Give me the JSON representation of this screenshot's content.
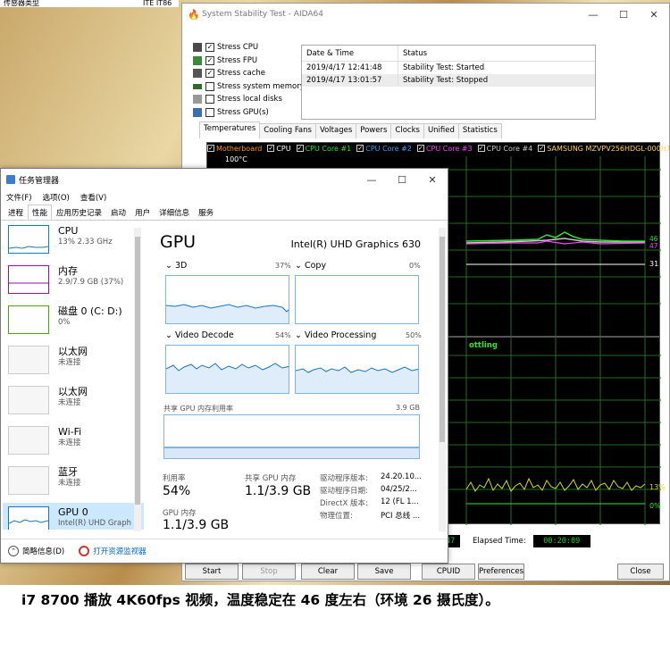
{
  "background": {
    "left_title": "传感器类型",
    "right_title": "ITE IT86"
  },
  "aida": {
    "window_title": "System Stability Test - AIDA64",
    "stress": [
      {
        "label": "Stress CPU",
        "checked": true,
        "icon": "cpu-icon"
      },
      {
        "label": "Stress FPU",
        "checked": true,
        "icon": "fpu-icon"
      },
      {
        "label": "Stress cache",
        "checked": true,
        "icon": "cache-icon"
      },
      {
        "label": "Stress system memory",
        "checked": false,
        "icon": "memory-icon"
      },
      {
        "label": "Stress local disks",
        "checked": false,
        "icon": "disk-icon"
      },
      {
        "label": "Stress GPU(s)",
        "checked": false,
        "icon": "gpu-icon"
      }
    ],
    "log": {
      "headers": [
        "Date & Time",
        "Status"
      ],
      "rows": [
        [
          "2019/4/17 12:41:48",
          "Stability Test: Started"
        ],
        [
          "2019/4/17 13:01:57",
          "Stability Test: Stopped"
        ]
      ]
    },
    "tabs": [
      "Temperatures",
      "Cooling Fans",
      "Voltages",
      "Powers",
      "Clocks",
      "Unified",
      "Statistics"
    ],
    "legend": [
      {
        "label": "Motherboard",
        "color": "#ff9900"
      },
      {
        "label": "CPU",
        "color": "#ffffff"
      },
      {
        "label": "CPU Core #1",
        "color": "#2ee62e"
      },
      {
        "label": "CPU Core #2",
        "color": "#2ea4ff"
      },
      {
        "label": "CPU Core #3",
        "color": "#ff40ff"
      },
      {
        "label": "CPU Core #4",
        "color": "#c8c8c8"
      },
      {
        "label": "SAMSUNG MZVPV256HDGL-000H1",
        "color": "#ffd24d"
      }
    ],
    "graph": {
      "ymax": "100°C",
      "readout1": "46",
      "readout1b": "47",
      "readout2": "31"
    },
    "throttle": {
      "label": "ottling",
      "pct_high": "13%",
      "pct_low": "0%"
    },
    "bottom": {
      "left_value": "47",
      "elapsed_label": "Elapsed Time:",
      "elapsed_value": "00:20:09"
    },
    "buttons": [
      "Start",
      "Stop",
      "Clear",
      "Save",
      "CPUID",
      "Preferences",
      "Close"
    ]
  },
  "taskmgr": {
    "title": "任务管理器",
    "menu": [
      "文件(F)",
      "选项(O)",
      "查看(V)"
    ],
    "tabs": [
      "进程",
      "性能",
      "应用历史记录",
      "启动",
      "用户",
      "详细信息",
      "服务"
    ],
    "side": [
      {
        "title": "CPU",
        "sub": "13% 2.33 GHz",
        "color": "#117dbb"
      },
      {
        "title": "内存",
        "sub": "2.9/7.9 GB (37%)",
        "color": "#8b12ae"
      },
      {
        "title": "磁盘 0 (C: D:)",
        "sub": "0%",
        "color": "#4da60c"
      },
      {
        "title": "以太网",
        "sub": "未连接",
        "color": "#aaaaaa"
      },
      {
        "title": "以太网",
        "sub": "未连接",
        "color": "#aaaaaa"
      },
      {
        "title": "Wi-Fi",
        "sub": "未连接",
        "color": "#aaaaaa"
      },
      {
        "title": "蓝牙",
        "sub": "未连接",
        "color": "#aaaaaa"
      },
      {
        "title": "GPU 0",
        "sub": "Intel(R) UHD Graph",
        "color": "#1a73c8"
      }
    ],
    "main": {
      "heading": "GPU",
      "device": "Intel(R) UHD Graphics 630",
      "engines": [
        {
          "name": "3D",
          "pct": "37%"
        },
        {
          "name": "Copy",
          "pct": "0%"
        },
        {
          "name": "Video Decode",
          "pct": "54%"
        },
        {
          "name": "Video Processing",
          "pct": "50%"
        }
      ],
      "shared_mem_label": "共享 GPU 内存利用率",
      "shared_mem_max": "3.9 GB",
      "util_label": "利用率",
      "util_value": "54%",
      "shared_label": "共享 GPU 内存",
      "shared_value": "1.1/3.9 GB",
      "gpu_mem_label": "GPU 内存",
      "gpu_mem_value": "1.1/3.9 GB",
      "info": [
        {
          "k": "驱动程序版本:",
          "v": "24.20.10..."
        },
        {
          "k": "驱动程序日期:",
          "v": "04/25/2..."
        },
        {
          "k": "DirectX 版本:",
          "v": "12 (FL 1..."
        },
        {
          "k": "物理位置:",
          "v": "PCI 总线 ..."
        }
      ]
    },
    "footer": {
      "brief": "简略信息(D)",
      "monitor": "打开资源监视器"
    }
  },
  "caption": "i7 8700 播放 4K60fps 视频，温度稳定在 46 度左右（环境 26 摄氏度）。"
}
